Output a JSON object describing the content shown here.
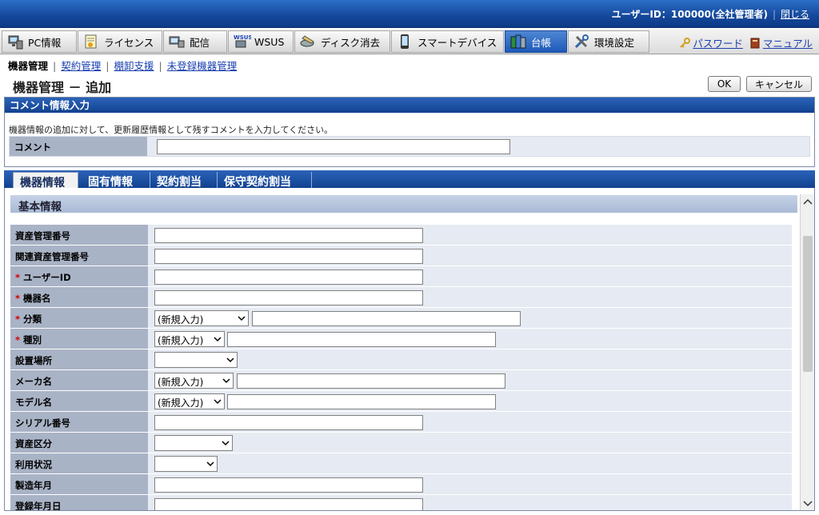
{
  "header": {
    "user_info": "ユーザーID：100000(全社管理者)",
    "close_label": "閉じる"
  },
  "menu": {
    "items": [
      {
        "label": "PC情報",
        "icon": "pc-icon"
      },
      {
        "label": "ライセンス",
        "icon": "license-icon"
      },
      {
        "label": "配信",
        "icon": "delivery-icon"
      },
      {
        "label": "WSUS",
        "icon": "wsus-icon"
      },
      {
        "label": "ディスク消去",
        "icon": "disk-erase-icon"
      },
      {
        "label": "スマートデバイス",
        "icon": "smartphone-icon"
      },
      {
        "label": "台帳",
        "icon": "ledger-icon"
      },
      {
        "label": "環境設定",
        "icon": "settings-icon"
      }
    ],
    "active": "台帳",
    "password_label": "パスワード",
    "manual_label": "マニュアル"
  },
  "submenu": {
    "current": "機器管理",
    "links": [
      "契約管理",
      "棚卸支援",
      "未登録機器管理"
    ]
  },
  "page": {
    "title": "機器管理 － 追加",
    "ok_label": "OK",
    "cancel_label": "キャンセル"
  },
  "comment_panel": {
    "heading": "コメント情報入力",
    "description": "機器情報の追加に対して、更新履歴情報として残すコメントを入力してください。",
    "label": "コメント",
    "value": ""
  },
  "tabs": [
    "機器情報",
    "固有情報",
    "契約割当",
    "保守契約割当"
  ],
  "active_tab": "機器情報",
  "form": {
    "section_title": "基本情報",
    "required_mark": "*",
    "fields": [
      {
        "label": "資産管理番号",
        "required": false,
        "value": ""
      },
      {
        "label": "関連資産管理番号",
        "required": false,
        "value": ""
      },
      {
        "label": "ユーザーID",
        "required": true,
        "value": ""
      },
      {
        "label": "機器名",
        "required": true,
        "value": ""
      },
      {
        "label": "分類",
        "required": true,
        "select_value": "(新規入力)",
        "value": ""
      },
      {
        "label": "種別",
        "required": true,
        "select_value": "(新規入力)",
        "value": ""
      },
      {
        "label": "設置場所",
        "required": false,
        "select_value": ""
      },
      {
        "label": "メーカ名",
        "required": false,
        "select_value": "(新規入力)",
        "value": ""
      },
      {
        "label": "モデル名",
        "required": false,
        "select_value": "(新規入力)",
        "value": ""
      },
      {
        "label": "シリアル番号",
        "required": false,
        "value": ""
      },
      {
        "label": "資産区分",
        "required": false,
        "select_value": ""
      },
      {
        "label": "利用状況",
        "required": false,
        "select_value": ""
      },
      {
        "label": "製造年月",
        "required": false,
        "value": ""
      },
      {
        "label": "登録年月日",
        "required": false,
        "value": ""
      }
    ]
  },
  "colors": {
    "header_blue": "#14479a",
    "label_bg": "#a9b3c6",
    "row_bg": "#e6eaf2",
    "required_red": "#d40000",
    "link_blue": "#1a3fb0"
  }
}
